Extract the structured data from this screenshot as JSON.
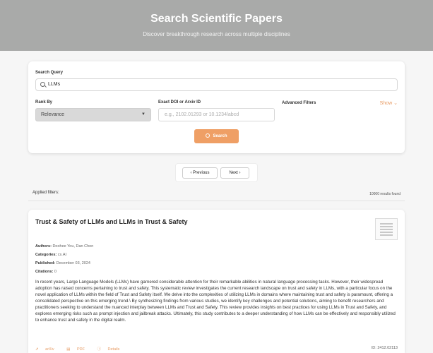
{
  "hero": {
    "title": "Search Scientific Papers",
    "subtitle": "Discover breakthrough research across multiple disciplines"
  },
  "search": {
    "query_label": "Search Query",
    "query_value": "LLMs",
    "rank_label": "Rank By",
    "rank_value": "Relevance",
    "doi_label": "Exact DOI or Arxiv ID",
    "doi_placeholder": "e.g., 2102.01293 or 10.1234/abcd",
    "advanced_label": "Advanced Filters",
    "show_label": "Show",
    "search_button": "Search"
  },
  "pagination": {
    "prev_label": "Previous",
    "next_label": "Next"
  },
  "filters": {
    "applied_label": "Applied filters:",
    "results_count": "10000 results found"
  },
  "result": {
    "title": "Trust & Safety of LLMs and LLMs in Trust & Safety",
    "authors_label": "Authors:",
    "authors": "Doohee You, Dan Chon",
    "categories_label": "Categories:",
    "categories": "cs.AI",
    "published_label": "Published:",
    "published": "December 03, 2024",
    "citations_label": "Citations:",
    "citations": "0",
    "abstract": "In recent years, Large Language Models (LLMs) have garnered considerable attention for their remarkable abilities in natural language processing tasks. However, their widespread adoption has raised concerns pertaining to trust and safety. This systematic review investigates the current research landscape on trust and safety in LLMs, with a particular focus on the novel application of LLMs within the field of Trust and Safety itself. We delve into the complexities of utilizing LLMs in domains where maintaining trust and safety is paramount, offering a consolidated perspective on this emerging trend.\\ By synthesizing findings from various studies, we identify key challenges and potential solutions, aiming to benefit researchers and practitioners seeking to understand the nuanced interplay between LLMs and Trust and Safety. This review provides insights on best practices for using LLMs in Trust and Safety, and explores emerging risks such as prompt injection and jailbreak attacks. Ultimately, this study contributes to a deeper understanding of how LLMs can be effectively and responsibly utilized to enhance trust and safety in the digital realm.",
    "link_arxiv": "arXiv",
    "link_pdf": "PDF",
    "link_details": "Details",
    "arxiv_id": "ID: 2412.02113"
  },
  "colors": {
    "accent": "#ef9f65",
    "hero_bg": "#a9aaa9"
  }
}
